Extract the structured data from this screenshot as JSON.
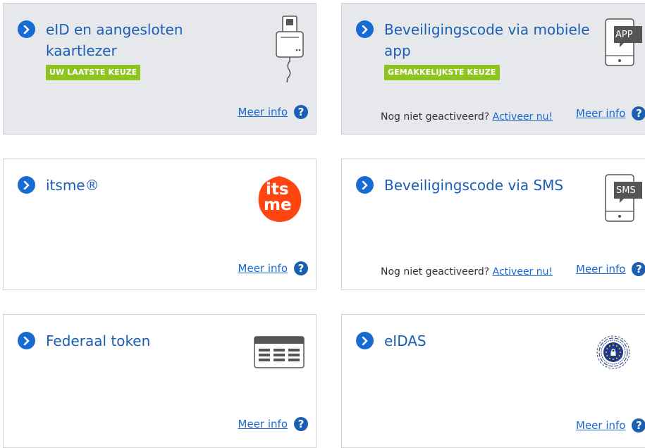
{
  "cards": [
    {
      "title": "eID en aangesloten kaartlezer",
      "badge": "UW LAATSTE KEUZE",
      "meer_info": "Meer info",
      "help_icon": "question-mark-icon",
      "illustration": "card-reader-icon",
      "selected": true
    },
    {
      "title": "Beveiligingscode via mobiele app",
      "badge": "GEMAKKELIJKSTE KEUZE",
      "activation_prefix": "Nog niet geactiveerd?",
      "activation_link": "Activeer nu!",
      "meer_info": "Meer info",
      "help_icon": "question-mark-icon",
      "illustration": "phone-app-icon",
      "illustration_label": "APP",
      "selected": true
    },
    {
      "title": "itsme®",
      "meer_info": "Meer info",
      "help_icon": "question-mark-icon",
      "illustration": "itsme-logo",
      "logo_text_top": "its",
      "logo_text_bottom": "me",
      "selected": false
    },
    {
      "title": "Beveiligingscode via SMS",
      "activation_prefix": "Nog niet geactiveerd?",
      "activation_link": "Activeer nu!",
      "meer_info": "Meer info",
      "help_icon": "question-mark-icon",
      "illustration": "phone-sms-icon",
      "illustration_label": "SMS",
      "selected": false
    },
    {
      "title": "Federaal token",
      "meer_info": "Meer info",
      "help_icon": "question-mark-icon",
      "illustration": "token-card-icon",
      "selected": false
    },
    {
      "title": "eIDAS",
      "meer_info": "Meer info",
      "help_icon": "question-mark-icon",
      "illustration": "eidas-logo",
      "selected": false
    }
  ],
  "colors": {
    "accent": "#1a6ad3",
    "title": "#1a5fb4",
    "badge": "#8fc31f",
    "selected_bg": "#e6e8eb",
    "itsme": "#ff4612"
  }
}
